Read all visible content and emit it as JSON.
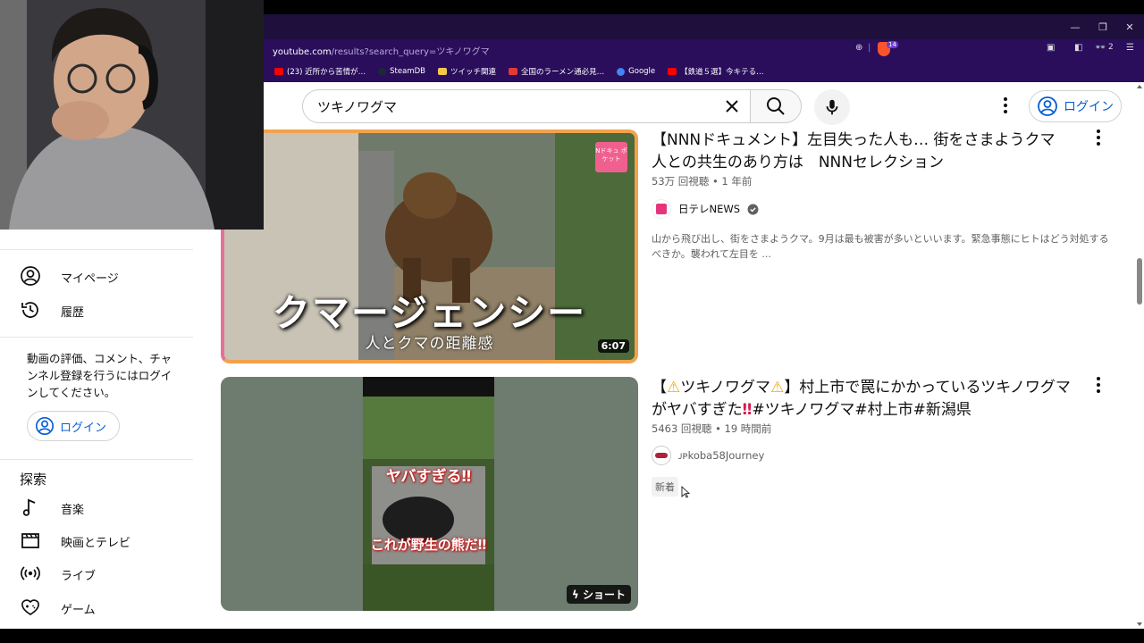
{
  "browser": {
    "url_host": "youtube.com",
    "url_path": "/results?search_query=ツキノワグマ",
    "extension_count": "2",
    "brave_badge": "14",
    "bookmarks": [
      {
        "label": "(23) 近所から苦情が…",
        "color": "#ff0000"
      },
      {
        "label": "SteamDB",
        "color": "#1b2838"
      },
      {
        "label": "ツイッチ関連",
        "color": "#f2c94c"
      },
      {
        "label": "全国のラーメン通必見…",
        "color": "#e53935"
      },
      {
        "label": "Google",
        "color": "#4285f4"
      },
      {
        "label": "【鉄道５選】今キテる…",
        "color": "#ff0000"
      }
    ]
  },
  "masthead": {
    "search_query": "ツキノワグマ",
    "login_label": "ログイン"
  },
  "sidebar": {
    "items": [
      {
        "label": "マイページ",
        "icon": "account-icon"
      },
      {
        "label": "履歴",
        "icon": "history-icon"
      }
    ],
    "signin_note": "動画の評価、コメント、チャンネル登録を行うにはログインしてください。",
    "login_label": "ログイン",
    "explore_heading": "探索",
    "explore_items": [
      {
        "label": "音楽",
        "icon": "music-icon"
      },
      {
        "label": "映画とテレビ",
        "icon": "movie-icon"
      },
      {
        "label": "ライブ",
        "icon": "live-icon"
      },
      {
        "label": "ゲーム",
        "icon": "game-icon"
      }
    ]
  },
  "results": [
    {
      "title": "【NNNドキュメント】左目失った人も… 街をさまようクマ 人との共生のあり方は　NNNセレクション",
      "meta": "53万 回視聴 • 1 年前",
      "channel": "日テレNEWS",
      "description": "山から飛び出し、街をさまようクマ。9月は最も被害が多いといいます。緊急事態にヒトはどう対処するべきか。襲われて左目を ...",
      "duration": "6:07",
      "thumb_caption": "クマージェンシー",
      "thumb_subcaption": "人とクマの距離感",
      "thumb_logo": "Nドキュ ポケット"
    },
    {
      "title_prefix": "【",
      "title_mid": "ツキノワグマ",
      "title_rest": "】村上市で罠にかかっているツキノワグマがヤバすぎた",
      "title_tags": "#ツキノワグマ#村上市#新潟県",
      "meta": "5463 回視聴 • 19 時間前",
      "channel": "ᴊᴘkoba58Journey",
      "new_badge": "新着",
      "shorts_label": "ショート",
      "overlay_top": "ヤバすぎる‼",
      "overlay_bottom": "これが野生の熊だ‼"
    }
  ]
}
